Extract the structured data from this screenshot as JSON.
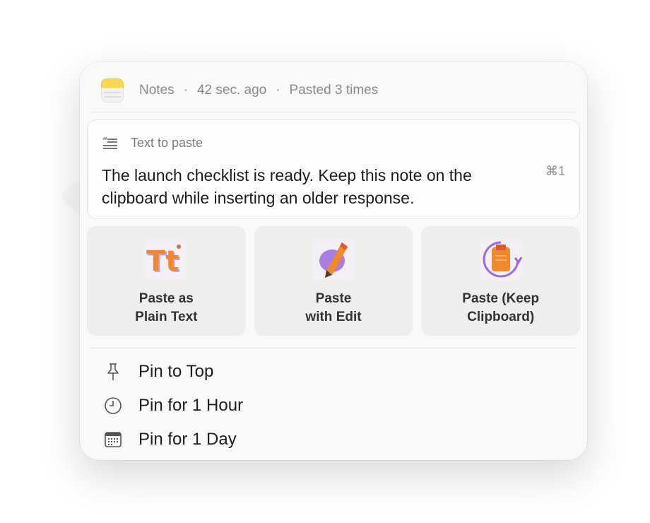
{
  "header": {
    "app_icon": "notes-app-icon",
    "app_name": "Notes",
    "time_ago": "42 sec. ago",
    "paste_count": "Pasted 3 times",
    "separator": "·"
  },
  "card": {
    "icon": "text-quote-icon",
    "title": "Text to paste",
    "body": "The launch checklist is ready. Keep this note on the clipboard while inserting an older response.",
    "shortcut": "⌘1"
  },
  "actions": [
    {
      "icon": "plain-text-icon",
      "label": "Paste as\nPlain Text"
    },
    {
      "icon": "edit-pencil-icon",
      "label": "Paste\nwith Edit"
    },
    {
      "icon": "keep-clipboard-icon",
      "label": "Paste (Keep\nClipboard)"
    }
  ],
  "menu": [
    {
      "icon": "pin-icon",
      "label": "Pin to Top"
    },
    {
      "icon": "clock-icon",
      "label": "Pin for 1 Hour"
    },
    {
      "icon": "calendar-icon",
      "label": "Pin for 1 Day"
    }
  ],
  "colors": {
    "popover_bg": "#f9f9f8",
    "tile_bg": "#eeeeed",
    "accent_orange": "#f0892e",
    "accent_purple": "#9a6ae0"
  }
}
